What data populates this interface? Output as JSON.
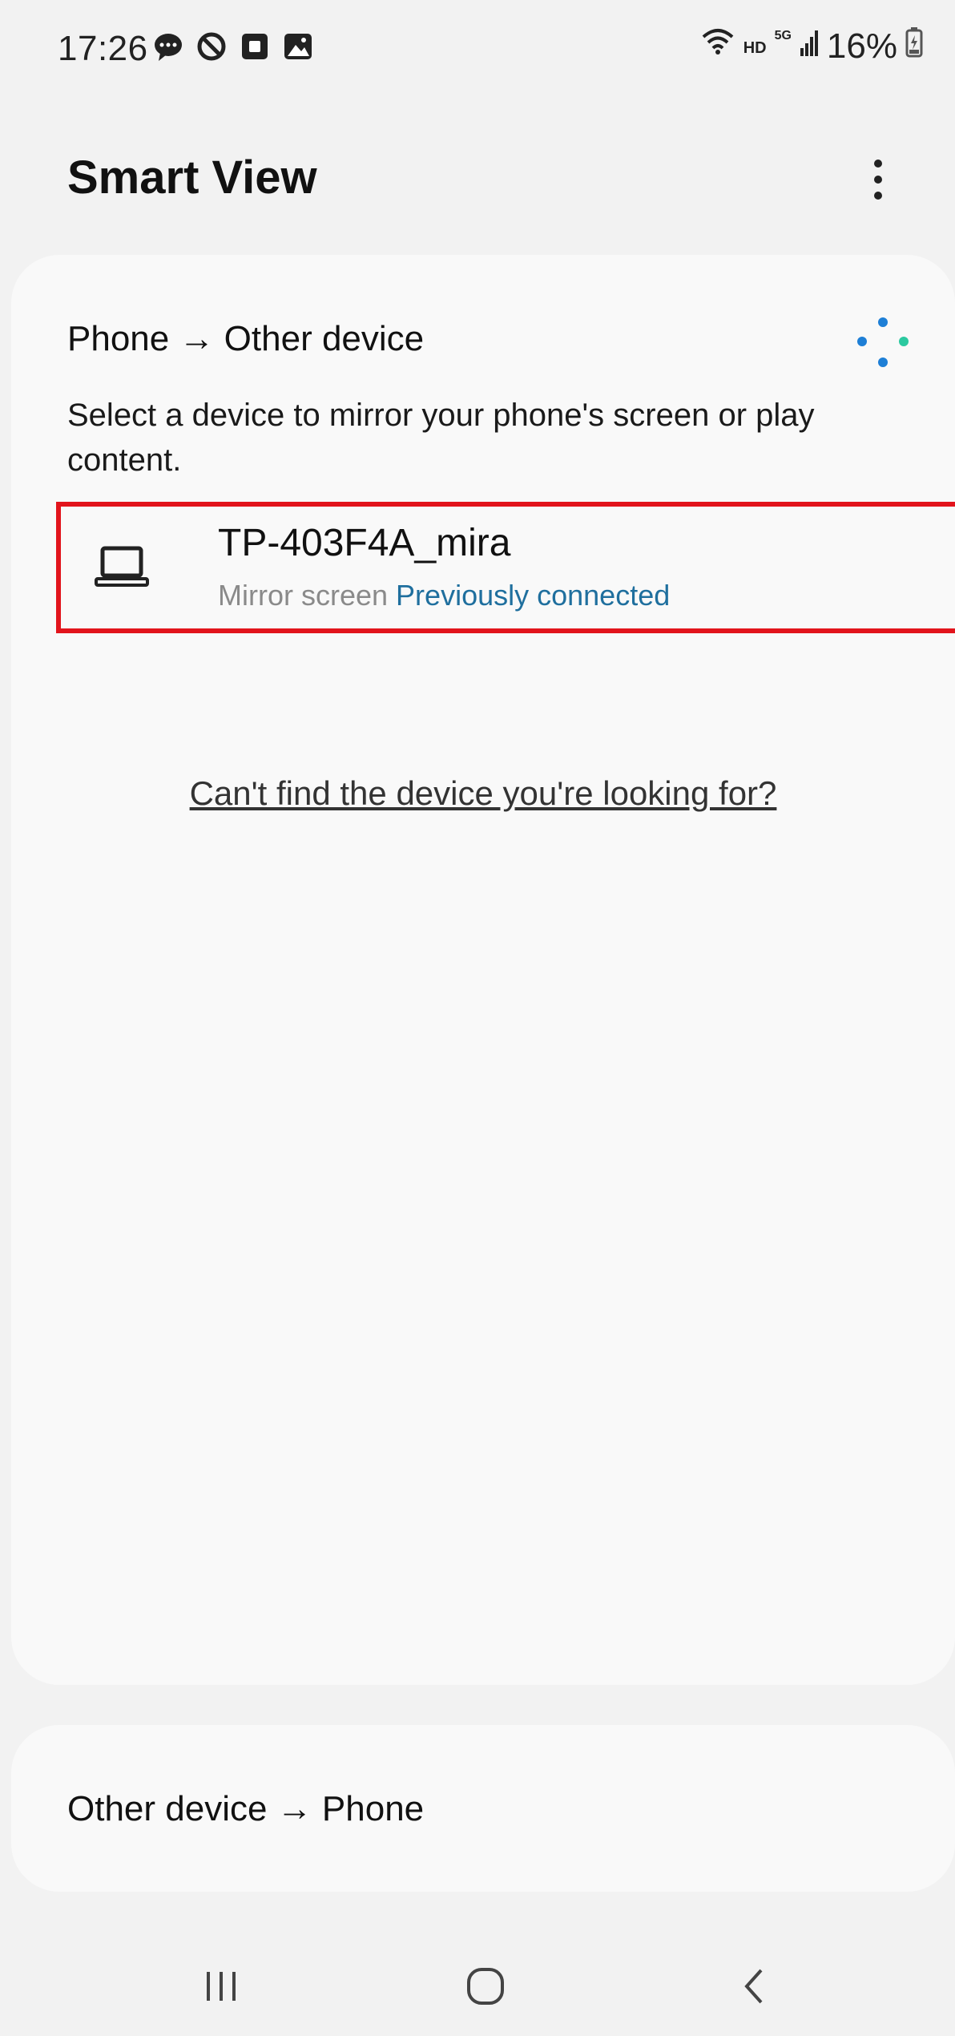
{
  "status_bar": {
    "time": "17:26",
    "left_icons": [
      "chat-bubble-icon",
      "blocked-icon",
      "square-notification-icon",
      "image-icon"
    ],
    "hd_label": "HD",
    "network_label": "5G",
    "battery": "16%"
  },
  "header": {
    "title": "Smart View",
    "more_icon": "more-vertical-icon"
  },
  "main_section": {
    "title": "Phone → Other device",
    "description": "Select a device to mirror your phone's screen or play content.",
    "devices": [
      {
        "name": "TP-403F4A_mira",
        "type": "Mirror screen",
        "status": "Previously connected",
        "icon": "laptop-icon"
      }
    ],
    "help_link": "Can't find the device you're looking for?"
  },
  "secondary_section": {
    "title": "Other device → Phone"
  },
  "colors": {
    "highlight_border": "#e2141c",
    "status_accent": "#1f6f9e",
    "scan_blue": "#1e7fd6",
    "scan_teal": "#2cc9a0"
  },
  "nav_icons": [
    "recents-icon",
    "home-icon",
    "back-icon"
  ]
}
